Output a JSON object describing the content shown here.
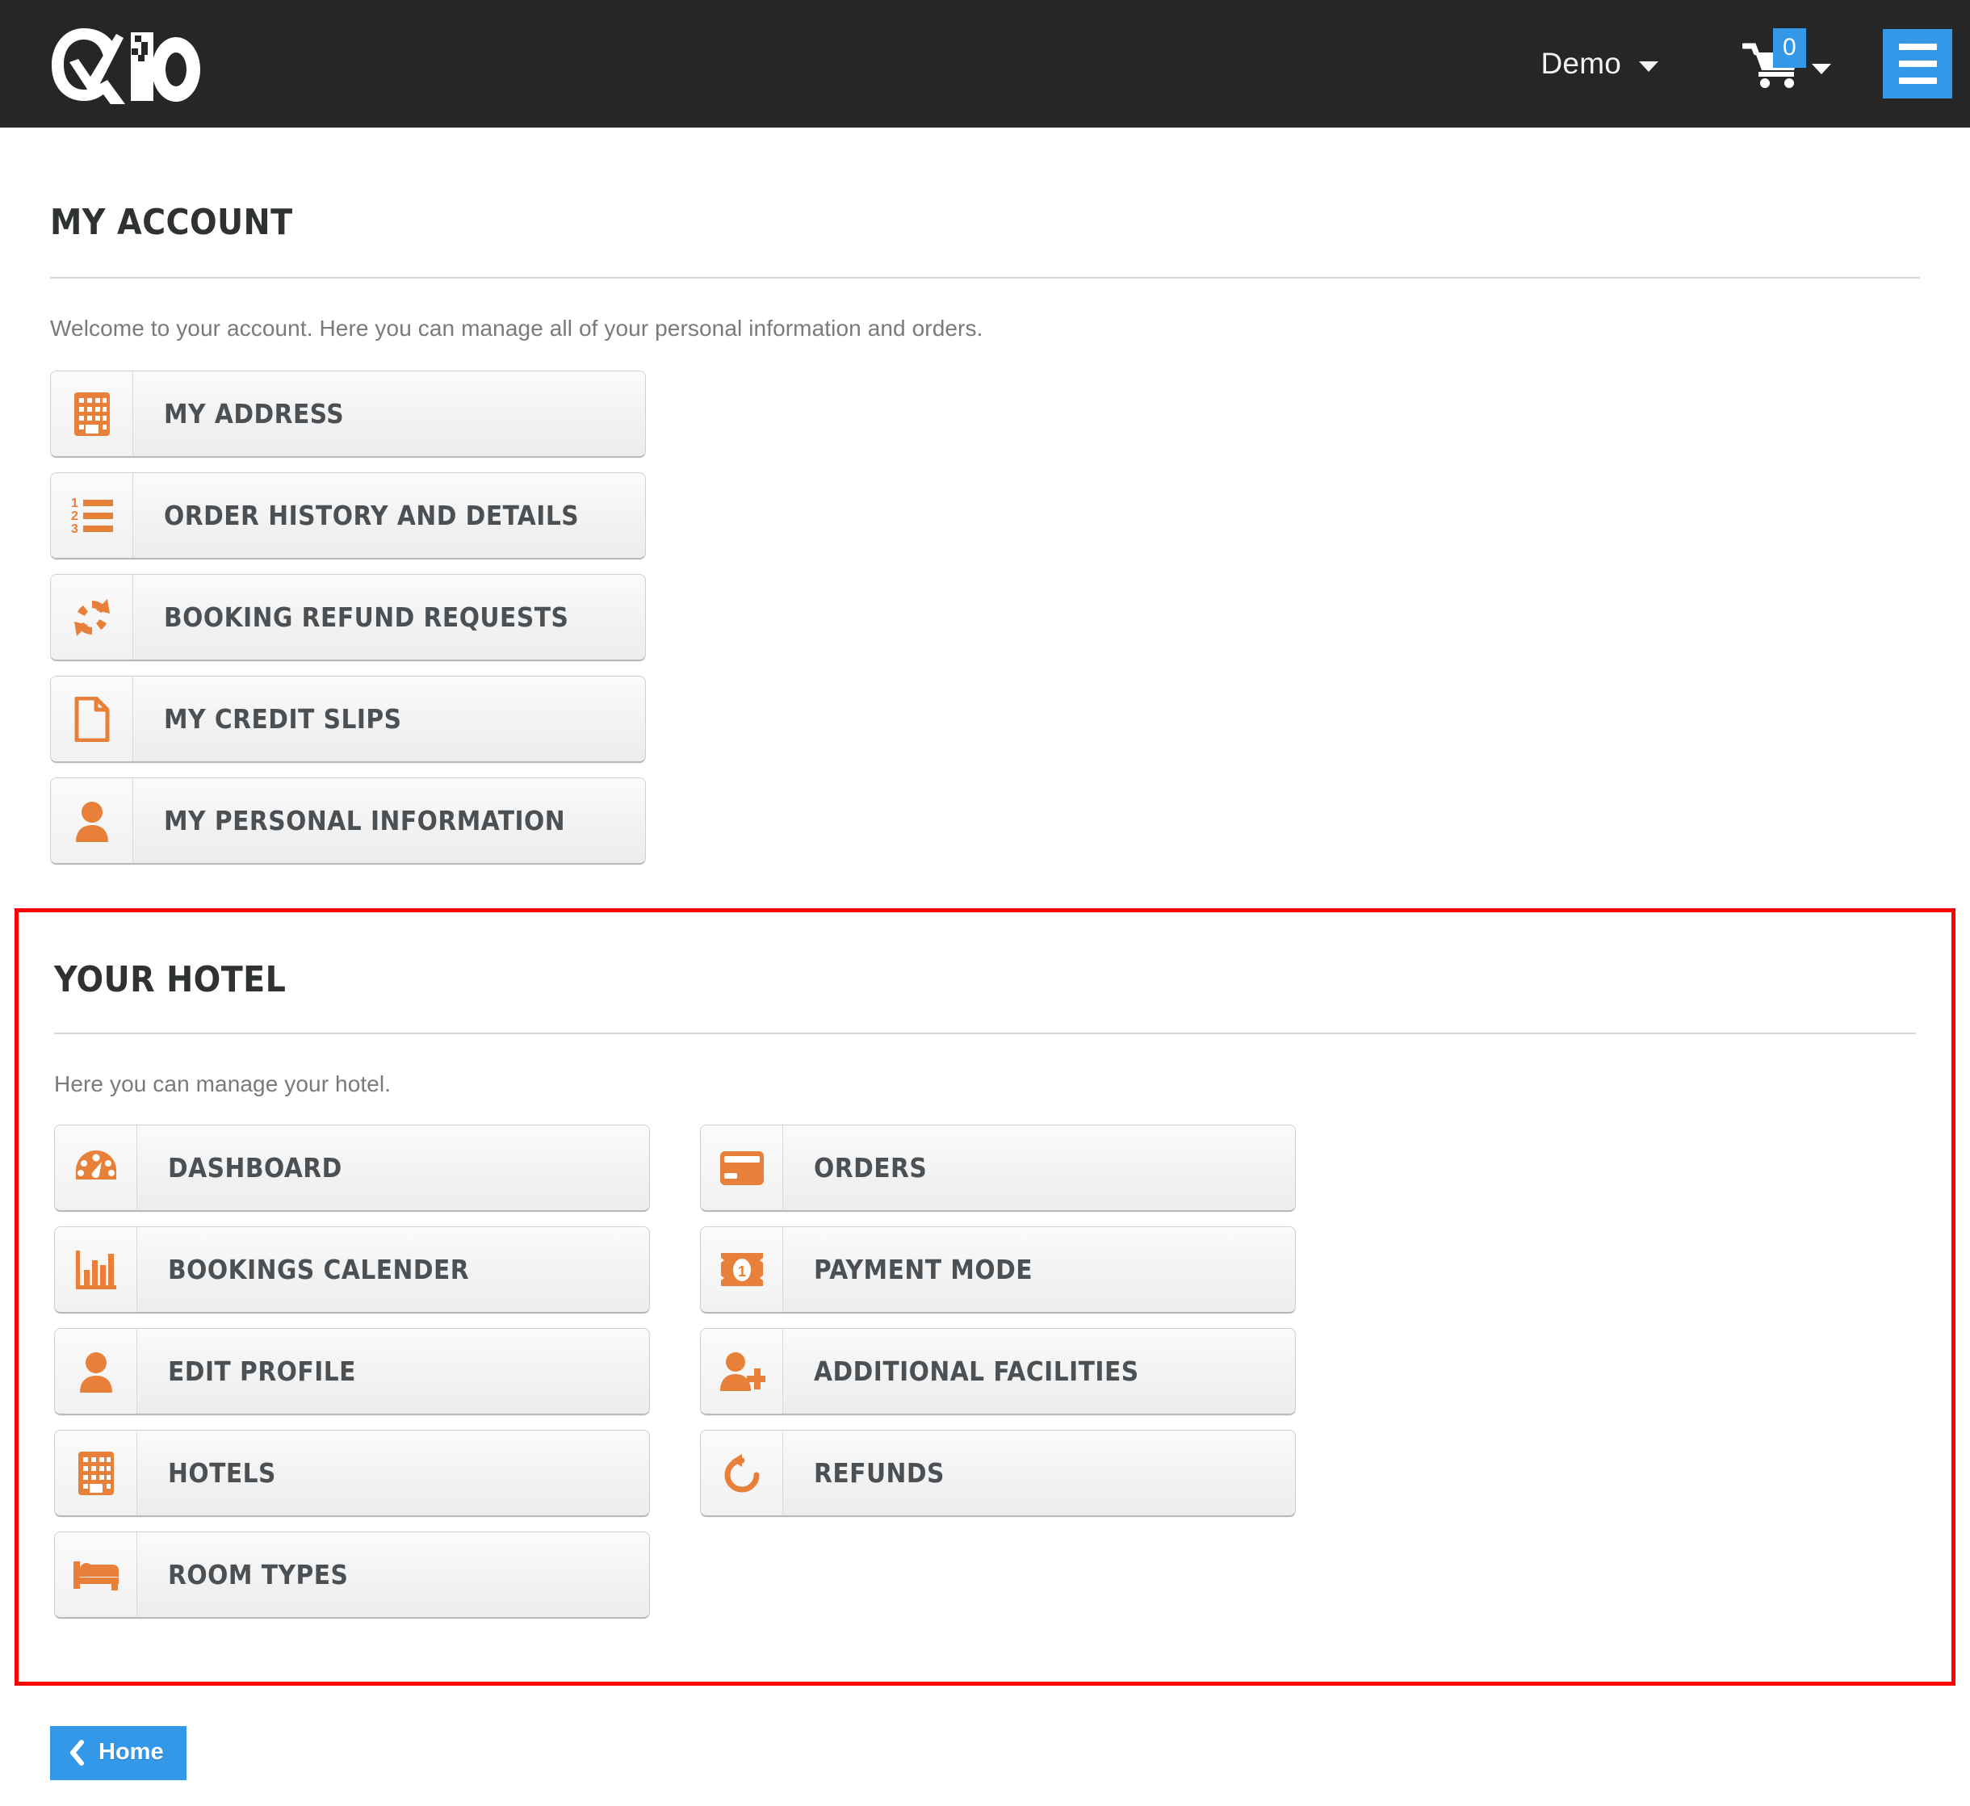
{
  "header": {
    "logo_alt": "QIO logo",
    "user_menu_label": "Demo",
    "cart_count": "0",
    "menu_button_label": "",
    "background_color": "#262626",
    "accent_color": "#3498e8"
  },
  "account": {
    "title": "MY ACCOUNT",
    "intro": "Welcome to your account. Here you can manage all of your personal information and orders.",
    "items": [
      {
        "label": "MY ADDRESS",
        "icon": "building-icon"
      },
      {
        "label": "ORDER HISTORY AND DETAILS",
        "icon": "ordered-list-icon"
      },
      {
        "label": "BOOKING REFUND REQUESTS",
        "icon": "refresh-icon"
      },
      {
        "label": "MY CREDIT SLIPS",
        "icon": "file-icon"
      },
      {
        "label": "MY PERSONAL INFORMATION",
        "icon": "user-icon"
      }
    ]
  },
  "hotel": {
    "title": "YOUR HOTEL",
    "intro": "Here you can manage your hotel.",
    "highlight_color": "#fe0000",
    "left_items": [
      {
        "label": "DASHBOARD",
        "icon": "tachometer-icon"
      },
      {
        "label": "BOOKINGS CALENDER",
        "icon": "bar-chart-icon"
      },
      {
        "label": "EDIT PROFILE",
        "icon": "user-icon"
      },
      {
        "label": "HOTELS",
        "icon": "building-icon"
      },
      {
        "label": "ROOM TYPES",
        "icon": "bed-icon"
      }
    ],
    "right_items": [
      {
        "label": "ORDERS",
        "icon": "credit-card-icon"
      },
      {
        "label": "PAYMENT MODE",
        "icon": "money-bill-icon"
      },
      {
        "label": "ADDITIONAL FACILITIES",
        "icon": "user-plus-icon"
      },
      {
        "label": "REFUNDS",
        "icon": "undo-icon"
      }
    ]
  },
  "footer": {
    "home_label": "Home"
  },
  "theme": {
    "icon_orange": "#e8803a",
    "label_gray": "#4b5055",
    "text_gray": "#7a7a7a"
  }
}
